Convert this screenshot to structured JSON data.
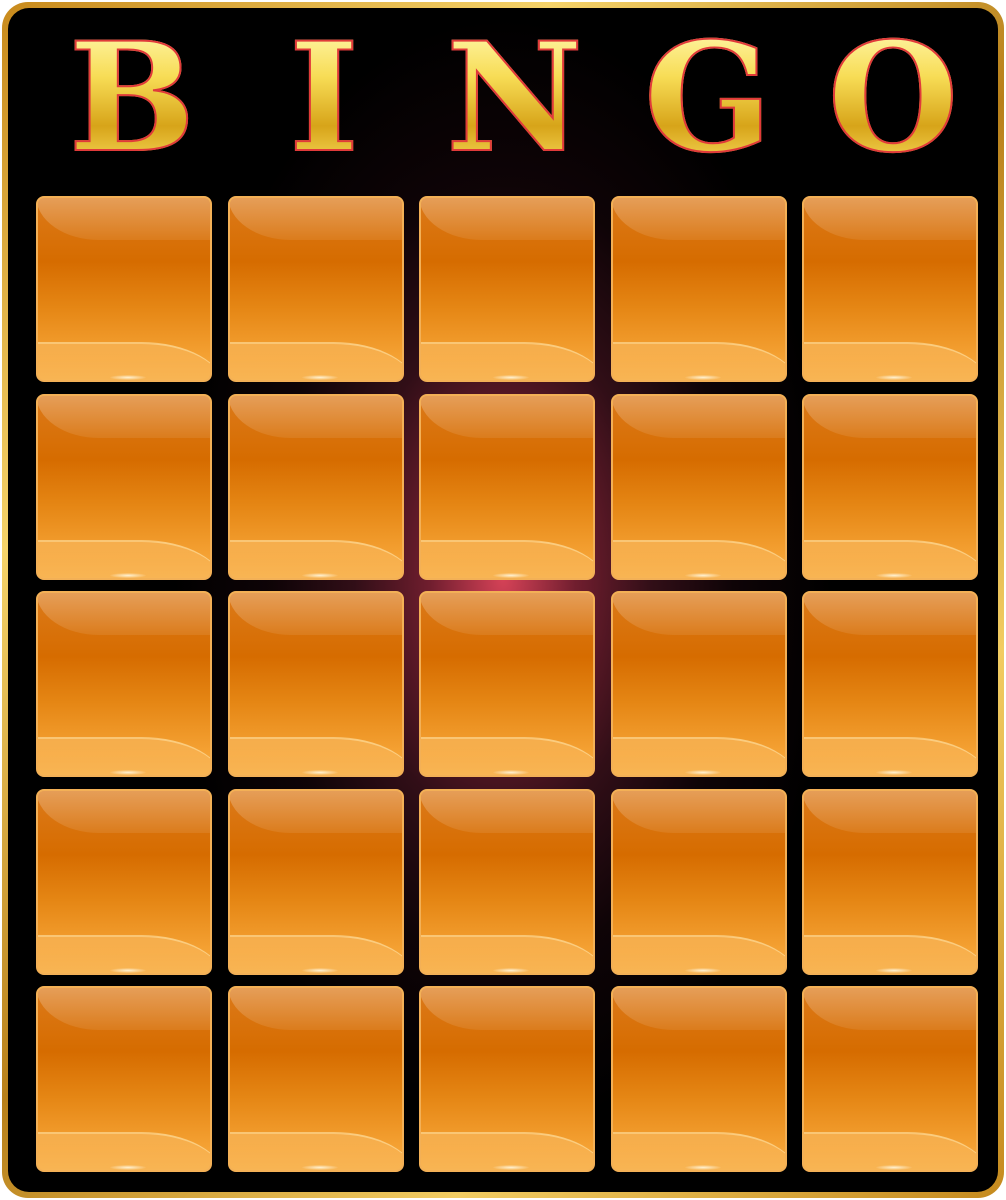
{
  "board": {
    "title_letters": [
      "B",
      "I",
      "N",
      "G",
      "O"
    ],
    "rows": 5,
    "columns": 5,
    "cells": [
      "",
      "",
      "",
      "",
      "",
      "",
      "",
      "",
      "",
      "",
      "",
      "",
      "",
      "",
      "",
      "",
      "",
      "",
      "",
      "",
      "",
      "",
      "",
      "",
      ""
    ]
  },
  "colors": {
    "frame_gold": "#d9a42a",
    "background_black": "#000000",
    "center_glow": "#e2465c",
    "tile_orange": "#e07a10",
    "tile_border": "#f3b056",
    "title_gold": "#f7dc55",
    "title_outline": "#e03a3a"
  }
}
